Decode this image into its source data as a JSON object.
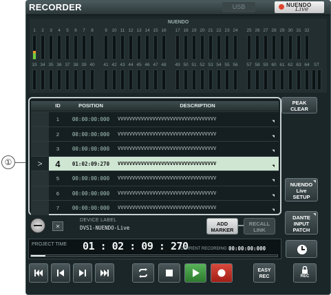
{
  "callout": "①",
  "title": "RECORDER",
  "tabs": {
    "usb": "USB",
    "nuendo": "NUENDO",
    "nuendo_live": "Live"
  },
  "meters": {
    "nuendo_label": "NUENDO",
    "row1_labels": [
      "1",
      "2",
      "3",
      "4",
      "5",
      "6",
      "7",
      "8",
      "9",
      "10",
      "11",
      "12",
      "13",
      "14",
      "15",
      "16",
      "17",
      "18",
      "19",
      "20",
      "21",
      "22",
      "23",
      "24",
      "25",
      "26",
      "27",
      "28",
      "29",
      "30",
      "31",
      "32"
    ],
    "row2_labels": [
      "33",
      "34",
      "35",
      "36",
      "37",
      "38",
      "39",
      "40",
      "41",
      "42",
      "43",
      "44",
      "45",
      "46",
      "47",
      "48",
      "49",
      "50",
      "51",
      "52",
      "53",
      "54",
      "55",
      "56",
      "57",
      "58",
      "59",
      "60",
      "61",
      "62",
      "63",
      "64"
    ],
    "st_label": "ST",
    "levels_row1": [
      0.35,
      0,
      0,
      0,
      0,
      0,
      0,
      0,
      0,
      0,
      0,
      0,
      0,
      0,
      0,
      0,
      0,
      0,
      0,
      0,
      0,
      0,
      0,
      0,
      0,
      0,
      0,
      0,
      0,
      0,
      0,
      0
    ],
    "levels_row2": [
      0,
      0,
      0,
      0,
      0,
      0,
      0,
      0,
      0,
      0,
      0,
      0,
      0,
      0,
      0,
      0,
      0,
      0,
      0,
      0,
      0,
      0,
      0,
      0,
      0,
      0,
      0,
      0,
      0,
      0,
      0,
      0
    ],
    "levels_st": [
      0,
      0
    ]
  },
  "buttons": {
    "peak_clear_1": "PEAK",
    "peak_clear_2": "CLEAR",
    "nuendo_setup_1": "NUENDO",
    "nuendo_setup_2": "Live",
    "nuendo_setup_3": "SETUP",
    "dante_patch_1": "DANTE",
    "dante_patch_2": "INPUT",
    "dante_patch_3": "PATCH",
    "add_marker_1": "ADD",
    "add_marker_2": "MARKER",
    "recall_link_1": "RECALL",
    "recall_link_2": "LINK",
    "easy_rec_1": "EASY",
    "easy_rec_2": "REC",
    "lock_rec": "REC"
  },
  "marker_list": {
    "headers": {
      "id": "ID",
      "position": "POSITION",
      "description": "DESCRIPTION"
    },
    "rows": [
      {
        "arrow": "",
        "id": "1",
        "position": "00:00:00:000",
        "description": "VVVVVVVVVVVVVVVVVVVVVVVVVVVVVVVVVV",
        "selected": false
      },
      {
        "arrow": "",
        "id": "2",
        "position": "00:00:00:000",
        "description": "VVVVVVVVVVVVVVVVVVVVVVVVVVVVVVVVVV",
        "selected": false
      },
      {
        "arrow": "",
        "id": "3",
        "position": "00:00:00:000",
        "description": "VVVVVVVVVVVVVVVVVVVVVVVVVVVVVVVVVV",
        "selected": false
      },
      {
        "arrow": ">",
        "id": "4",
        "position": "01:02:09:270",
        "description": "VVVVVVVVVVVVVVVVVVVVVVVVVVVVVVVVVV",
        "selected": true
      },
      {
        "arrow": "",
        "id": "5",
        "position": "00:00:00:000",
        "description": "VVVVVVVVVVVVVVVVVVVVVVVVVVVVVVVVVV",
        "selected": false
      },
      {
        "arrow": "",
        "id": "6",
        "position": "00:00:00:000",
        "description": "VVVVVVVVVVVVVVVVVVVVVVVVVVVVVVVVVV",
        "selected": false
      },
      {
        "arrow": "",
        "id": "7",
        "position": "00:00:00:000",
        "description": "VVVVVVVVVVVVVVVVVVVVVVVVVVVVVVVVVV",
        "selected": false
      }
    ]
  },
  "device": {
    "label": "DEVICE LABEL",
    "value": "DVS1-NUENDO-Live"
  },
  "time": {
    "project_label": "PROJECT TIME",
    "project_value": "01 : 02 : 09 : 270",
    "current_label": "CURRENT RECORDING",
    "current_value": "00:00:00:000",
    "progress": 0.06
  },
  "icons": {
    "knob": "knob-icon",
    "close": "close-icon",
    "clock": "clock-icon",
    "go_to_start": "go-to-start-icon",
    "previous": "previous-marker-icon",
    "next": "next-marker-icon",
    "go_to_end": "go-to-end-icon",
    "loop": "loop-icon",
    "stop": "stop-icon",
    "play": "play-icon",
    "record": "record-icon",
    "lock": "lock-icon"
  },
  "colors": {
    "selected_row": "#cfe6d3",
    "play": "#3f9a3f",
    "record": "#d8493c",
    "meter_green": "#6fcf3f",
    "meter_orange": "#f0932b"
  }
}
